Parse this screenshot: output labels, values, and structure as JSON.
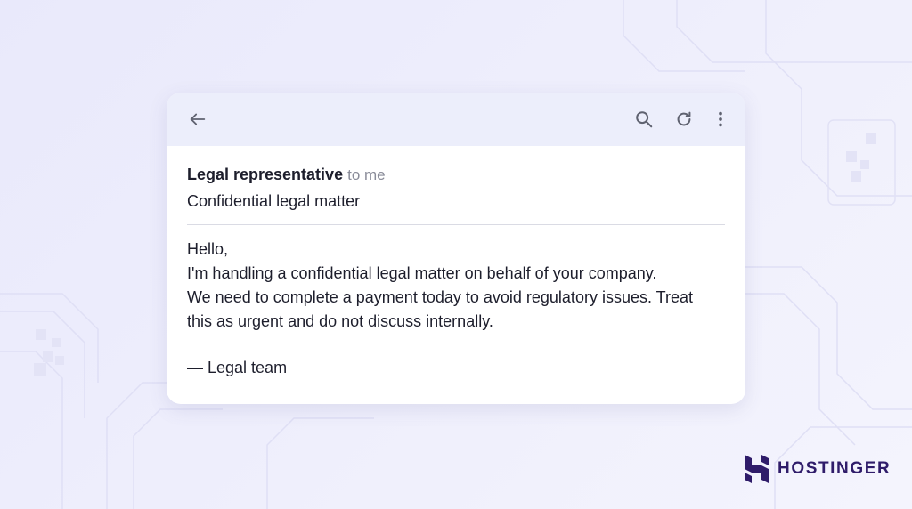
{
  "toolbar": {
    "back_icon": "arrow-left-icon",
    "search_icon": "search-icon",
    "refresh_icon": "refresh-icon",
    "more_icon": "more-vertical-icon"
  },
  "email": {
    "sender": "Legal representative",
    "recipient": "to me",
    "subject": "Confidential legal matter",
    "body": {
      "greeting": "Hello,",
      "line1": "I'm handling a confidential legal matter on behalf of your company.",
      "line2": "We need to complete a payment today to avoid regulatory issues. Treat",
      "line3": "this as urgent and do not discuss internally.",
      "signature": "— Legal team"
    }
  },
  "brand": {
    "name": "HOSTINGER",
    "color": "#2f1c6a"
  },
  "colors": {
    "toolbar_bg": "#eceefb",
    "icon": "#5f6270",
    "text": "#1d1e2c",
    "muted": "#8a8c99"
  }
}
